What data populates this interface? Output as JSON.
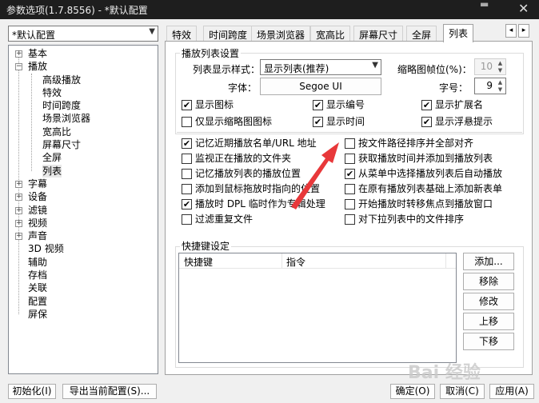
{
  "window": {
    "title": "参数选项(1.7.8556) - *默认配置",
    "close": "✕",
    "dots": "▬"
  },
  "profile_select": {
    "value": "*默认配置"
  },
  "tree": [
    {
      "label": "基本",
      "level": 0,
      "expander": "+"
    },
    {
      "label": "播放",
      "level": 0,
      "expander": "−"
    },
    {
      "label": "高级播放",
      "level": 1
    },
    {
      "label": "特效",
      "level": 1
    },
    {
      "label": "时间跨度",
      "level": 1
    },
    {
      "label": "场景浏览器",
      "level": 1
    },
    {
      "label": "宽高比",
      "level": 1
    },
    {
      "label": "屏幕尺寸",
      "level": 1
    },
    {
      "label": "全屏",
      "level": 1
    },
    {
      "label": "列表",
      "level": 1,
      "selected": true
    },
    {
      "label": "字幕",
      "level": 0,
      "expander": "+"
    },
    {
      "label": "设备",
      "level": 0,
      "expander": "+"
    },
    {
      "label": "滤镜",
      "level": 0,
      "expander": "+"
    },
    {
      "label": "视频",
      "level": 0,
      "expander": "+"
    },
    {
      "label": "声音",
      "level": 0,
      "expander": "+"
    },
    {
      "label": "3D 视频",
      "level": 0
    },
    {
      "label": "辅助",
      "level": 0
    },
    {
      "label": "存档",
      "level": 0
    },
    {
      "label": "关联",
      "level": 0
    },
    {
      "label": "配置",
      "level": 0
    },
    {
      "label": "屏保",
      "level": 0
    }
  ],
  "tabs": [
    {
      "label": "特效"
    },
    {
      "label": "时间跨度"
    },
    {
      "label": "场景浏览器"
    },
    {
      "label": "宽高比"
    },
    {
      "label": "屏幕尺寸"
    },
    {
      "label": "全屏"
    },
    {
      "label": "列表",
      "active": true
    }
  ],
  "tab_scroll": {
    "left": "◂",
    "right": "▸"
  },
  "playlist_settings": {
    "group_title": "播放列表设置",
    "style_label": "列表显示样式：",
    "style_value": "显示列表(推荐)",
    "thumb_label": "缩略图帧位(%)：",
    "thumb_value": "10",
    "font_label": "字体：",
    "font_value": "Segoe UI",
    "size_label": "字号：",
    "size_value": "9"
  },
  "checks_top": [
    {
      "label": "显示图标",
      "checked": true
    },
    {
      "label": "显示编号",
      "checked": true
    },
    {
      "label": "显示扩展名",
      "checked": true
    },
    {
      "label": "仅显示缩略图图标",
      "checked": false
    },
    {
      "label": "显示时间",
      "checked": true
    },
    {
      "label": "显示浮悬提示",
      "checked": true
    }
  ],
  "checks_left": [
    {
      "label": "记忆近期播放名单/URL 地址",
      "checked": true
    },
    {
      "label": "监视正在播放的文件夹",
      "checked": false
    },
    {
      "label": "记忆播放列表的播放位置",
      "checked": false
    },
    {
      "label": "添加到鼠标拖放时指向的位置",
      "checked": false
    },
    {
      "label": "播放时 DPL 临时作为专辑处理",
      "checked": true
    },
    {
      "label": "过滤重复文件",
      "checked": false
    }
  ],
  "checks_right": [
    {
      "label": "按文件路径排序并全部对齐",
      "checked": false
    },
    {
      "label": "获取播放时间并添加到播放列表",
      "checked": false
    },
    {
      "label": "从菜单中选择播放列表后自动播放",
      "checked": true
    },
    {
      "label": "在原有播放列表基础上添加新表单",
      "checked": false
    },
    {
      "label": "开始播放时转移焦点到播放窗口",
      "checked": false
    },
    {
      "label": "对下拉列表中的文件排序",
      "checked": false
    }
  ],
  "shortcuts": {
    "group_title": "快捷键设定",
    "col_key": "快捷键",
    "col_cmd": "指令",
    "buttons": [
      "添加...",
      "移除",
      "修改",
      "上移",
      "下移"
    ]
  },
  "bottom": {
    "init": "初始化(I)",
    "export": "导出当前配置(S)...",
    "ok": "确定(O)",
    "cancel": "取消(C)",
    "apply": "应用(A)"
  },
  "watermark": "Bai 经验",
  "colors": {
    "annotation_arrow": "#e8383a"
  }
}
